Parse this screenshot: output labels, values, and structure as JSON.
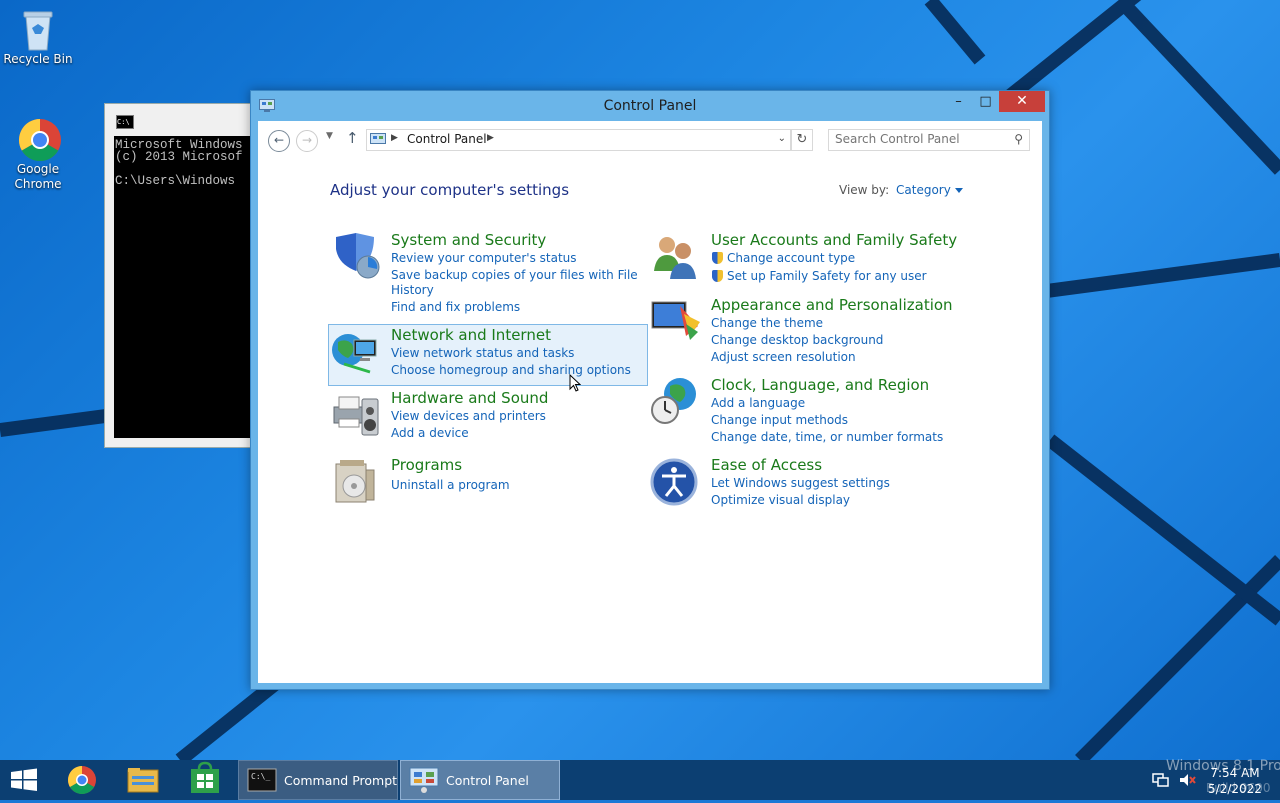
{
  "desktop": {
    "icons": [
      {
        "label": "Recycle Bin"
      },
      {
        "label": "Google Chrome"
      }
    ]
  },
  "cmd_window": {
    "lines": [
      "Microsoft Windows",
      "(c) 2013 Microsof",
      "",
      "C:\\Users\\Windows"
    ]
  },
  "control_panel": {
    "title": "Control Panel",
    "breadcrumb": "Control Panel",
    "search_placeholder": "Search Control Panel",
    "heading": "Adjust your computer's settings",
    "view_by_label": "View by:",
    "view_by_value": "Category",
    "categories": [
      {
        "title": "System and Security",
        "links": [
          "Review your computer's status",
          "Save backup copies of your files with File",
          "History",
          "Find and fix problems"
        ]
      },
      {
        "title": "Network and Internet",
        "links": [
          "View network status and tasks",
          "Choose homegroup and sharing options"
        ]
      },
      {
        "title": "Hardware and Sound",
        "links": [
          "View devices and printers",
          "Add a device"
        ]
      },
      {
        "title": "Programs",
        "links": [
          "Uninstall a program"
        ]
      },
      {
        "title": "User Accounts and Family Safety",
        "links": [
          "Change account type",
          "Set up Family Safety for any user"
        ]
      },
      {
        "title": "Appearance and Personalization",
        "links": [
          "Change the theme",
          "Change desktop background",
          "Adjust screen resolution"
        ]
      },
      {
        "title": "Clock, Language, and Region",
        "links": [
          "Add a language",
          "Change input methods",
          "Change date, time, or number formats"
        ]
      },
      {
        "title": "Ease of Access",
        "links": [
          "Let Windows suggest settings",
          "Optimize visual display"
        ]
      }
    ]
  },
  "taskbar": {
    "cmd_label": "Command Prompt",
    "cp_label": "Control Panel",
    "time": "7:54 AM",
    "date": "5/2/2022",
    "watermark": "Windows 8.1 Pro",
    "watermark_build": "Build 9600"
  },
  "colors": {
    "link": "#1464b8",
    "category_title": "#1a7a1a",
    "heading": "#1e3287",
    "window_frame": "#6ab5e9",
    "close": "#c7403a",
    "taskbar": "#0c3f72"
  }
}
